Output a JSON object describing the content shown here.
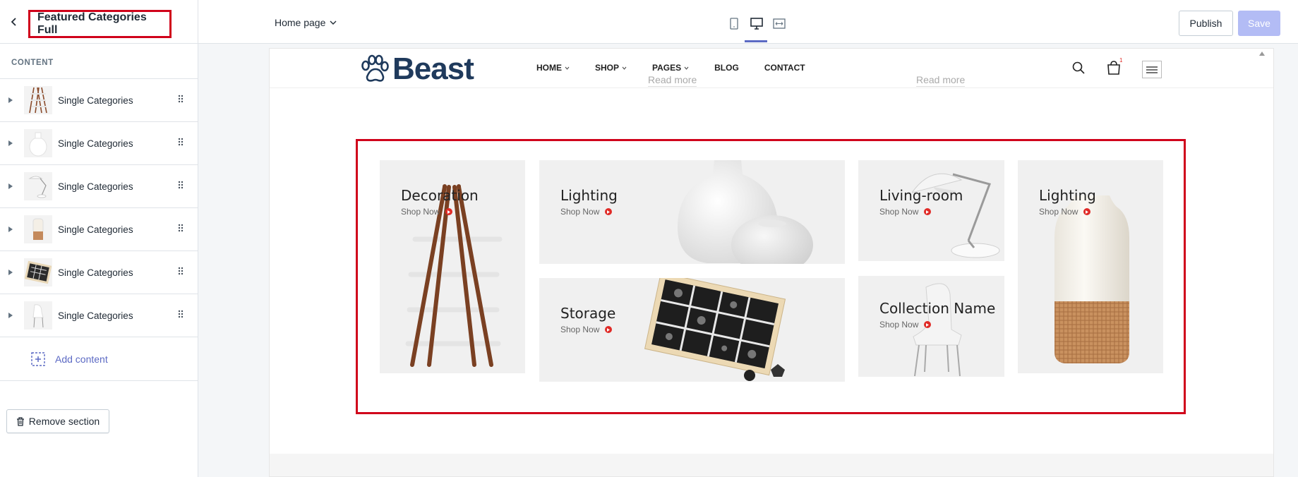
{
  "sidebar": {
    "section_title": "Featured Categories Full",
    "content_label": "CONTENT",
    "items": [
      {
        "label": "Single Categories",
        "thumb": "ladder-shelf"
      },
      {
        "label": "Single Categories",
        "thumb": "white-vase"
      },
      {
        "label": "Single Categories",
        "thumb": "desk-lamp"
      },
      {
        "label": "Single Categories",
        "thumb": "ceramic-vase"
      },
      {
        "label": "Single Categories",
        "thumb": "storage-box"
      },
      {
        "label": "Single Categories",
        "thumb": "white-chair"
      }
    ],
    "add_content": "Add content",
    "remove_section": "Remove section"
  },
  "topbar": {
    "page_selector": "Home page",
    "devices": [
      "mobile",
      "desktop",
      "full-width"
    ],
    "active_device": "desktop",
    "publish": "Publish",
    "save": "Save"
  },
  "preview": {
    "logo": "Beast",
    "nav": [
      {
        "label": "HOME",
        "dropdown": true
      },
      {
        "label": "SHOP",
        "dropdown": true
      },
      {
        "label": "PAGES",
        "dropdown": true
      },
      {
        "label": "BLOG",
        "dropdown": false
      },
      {
        "label": "CONTACT",
        "dropdown": false
      }
    ],
    "read_more_1": "Read more",
    "read_more_2": "Read more",
    "cart_count": "1",
    "categories": [
      {
        "title": "Decoration",
        "cta": "Shop Now"
      },
      {
        "title": "Lighting",
        "cta": "Shop Now"
      },
      {
        "title": "Living-room",
        "cta": "Shop Now"
      },
      {
        "title": "Lighting",
        "cta": "Shop Now"
      },
      {
        "title": "Storage",
        "cta": "Shop Now"
      },
      {
        "title": "Collection Name",
        "cta": "Shop Now"
      }
    ]
  },
  "colors": {
    "selection": "#d0021b",
    "accent": "#5c6ac4",
    "brand": "#1f3a5c",
    "shop_dot": "#e02b27"
  }
}
